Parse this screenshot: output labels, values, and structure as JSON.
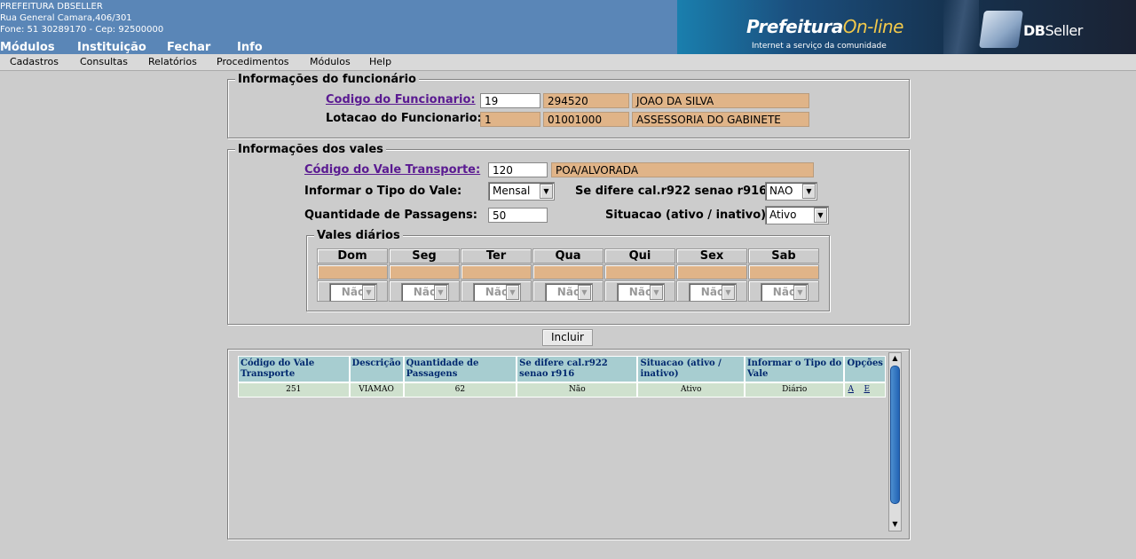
{
  "header": {
    "org": "PREFEITURA DBSELLER",
    "address": "Rua General Camara,406/301",
    "contact": "Fone: 51 30289170  -  Cep: 92500000",
    "nav": [
      "Módulos",
      "Instituição",
      "Fechar",
      "Info"
    ],
    "banner_prefeitura": "Prefeitura",
    "banner_online": "On-line",
    "banner_tagline": "Internet a serviço da comunidade",
    "dbseller_db": "DB",
    "dbseller_seller": "Seller"
  },
  "menubar": [
    "Cadastros",
    "Consultas",
    "Relatórios",
    "Procedimentos",
    "Módulos",
    "Help"
  ],
  "funcionario": {
    "legend": "Informações do funcionário",
    "codigo_label": "Codigo do Funcionario:",
    "codigo_value": "19",
    "codigo_matricula": "294520",
    "codigo_nome": "JOAO DA SILVA",
    "lotacao_label": "Lotacao do Funcionario:",
    "lotacao_value": "1",
    "lotacao_codigo": "01001000",
    "lotacao_desc": "ASSESSORIA DO GABINETE"
  },
  "vales": {
    "legend": "Informações dos vales",
    "codigo_label": "Código do Vale Transporte:",
    "codigo_value": "120",
    "codigo_desc": "POA/ALVORADA",
    "tipo_label": "Informar o Tipo do Vale:",
    "tipo_value": "Mensal",
    "difere_label": "Se difere cal.r922 senao r916:",
    "difere_value": "NAO",
    "qtd_label": "Quantidade de Passagens:",
    "qtd_value": "50",
    "situacao_label": "Situacao (ativo / inativo):",
    "situacao_value": "Ativo",
    "diarios_legend": "Vales diários",
    "dias": [
      "Dom",
      "Seg",
      "Ter",
      "Qua",
      "Qui",
      "Sex",
      "Sab"
    ],
    "dia_select": "Não"
  },
  "incluir_label": "Incluir",
  "grid": {
    "headers": [
      "Código do Vale Transporte",
      "Descrição",
      "Quantidade de Passagens",
      "Se difere cal.r922 senao r916",
      "Situacao (ativo / inativo)",
      "Informar o Tipo do Vale",
      "Opções"
    ],
    "row": {
      "codigo": "251",
      "descricao": "VIAMAO",
      "quantidade": "62",
      "difere": "Não",
      "situacao": "Ativo",
      "tipo": "Diário",
      "opt_a": "A",
      "opt_e": "E"
    }
  }
}
